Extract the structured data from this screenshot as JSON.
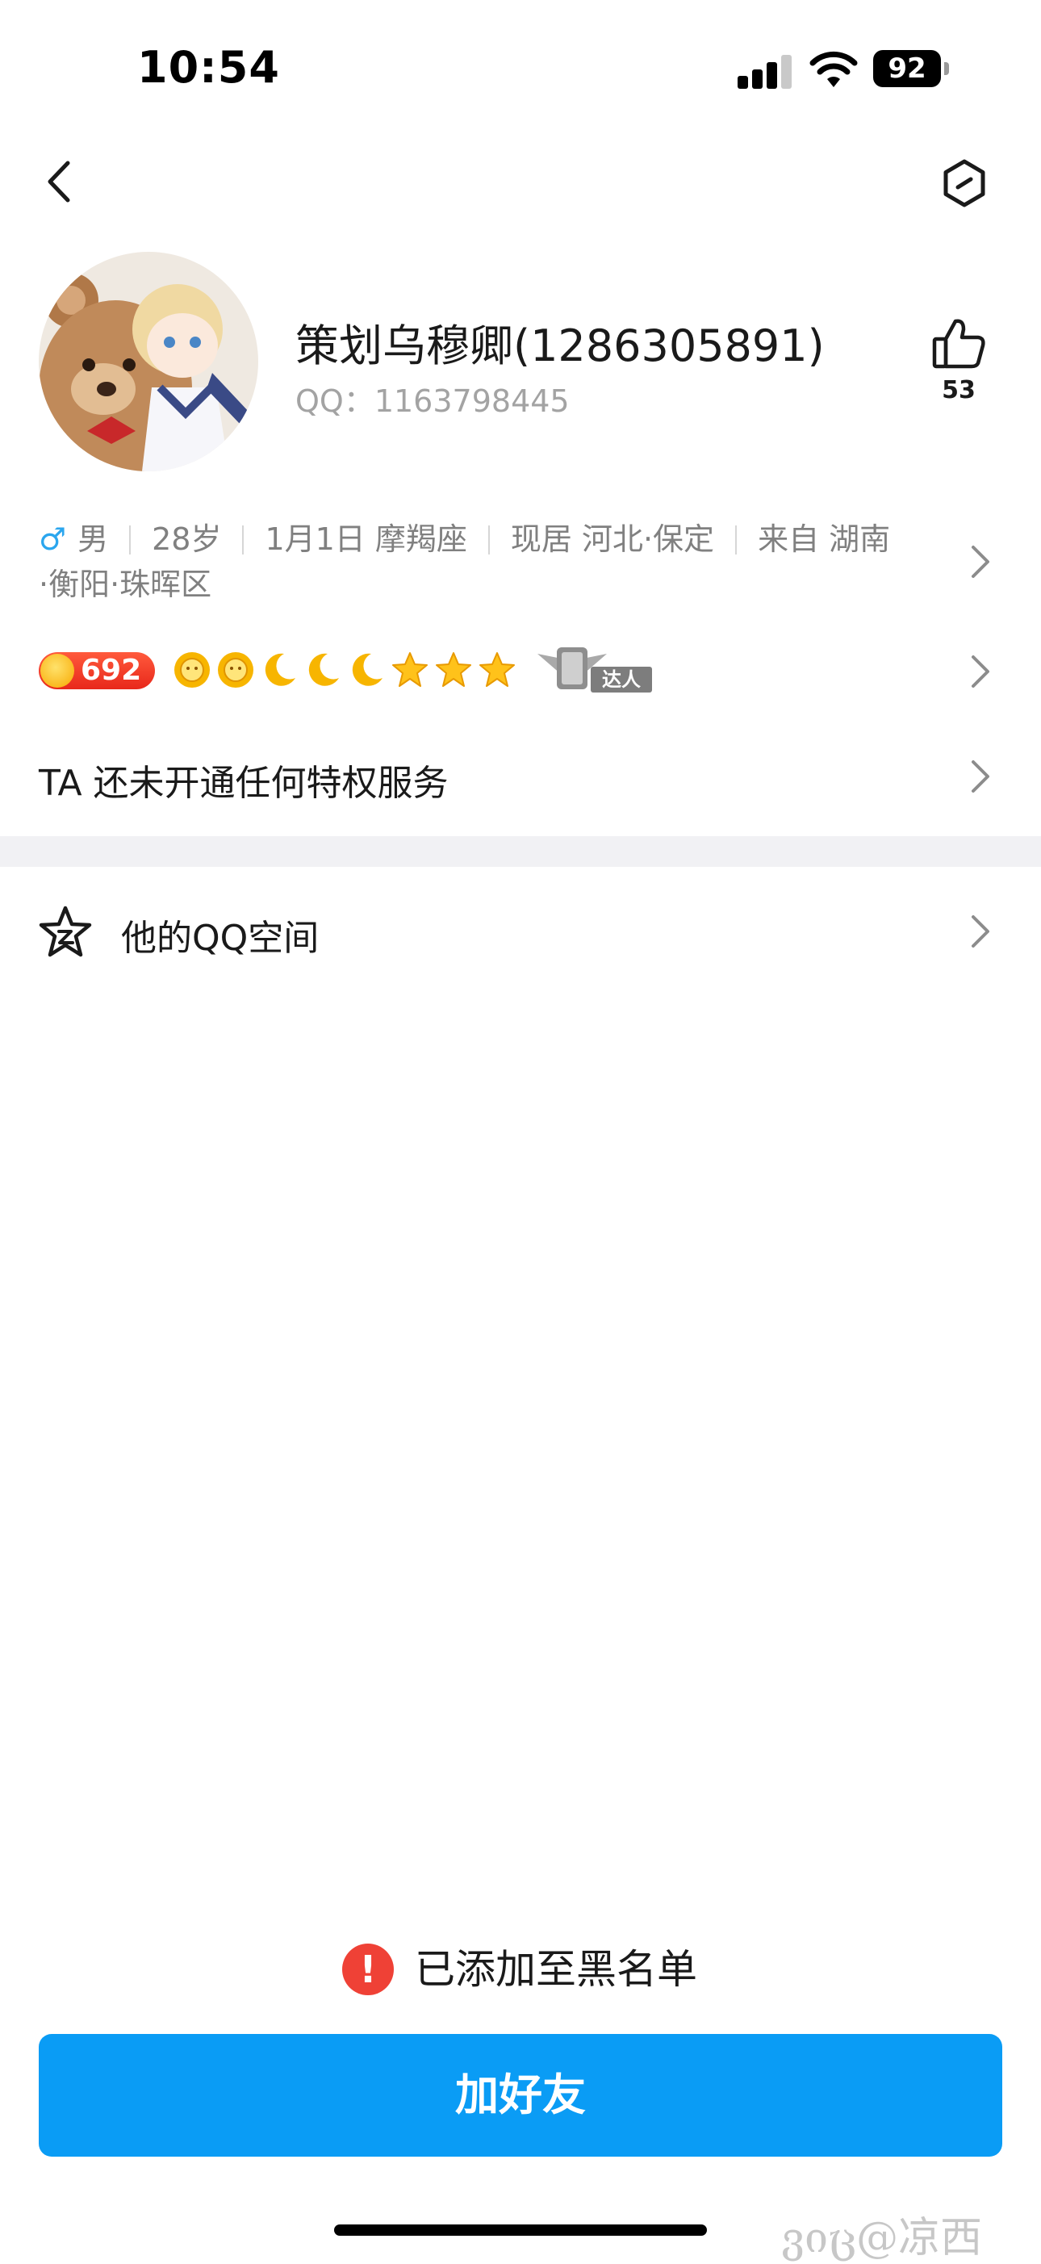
{
  "status_bar": {
    "time": "10:54",
    "battery": "92"
  },
  "nav": {
    "back_icon": "chevron-left-icon",
    "settings_icon": "hexagon-settings-icon"
  },
  "profile": {
    "nickname": "策划乌穆卿(1286305891)",
    "qq_label": "QQ：",
    "qq_number": "1163798445",
    "likes": "53"
  },
  "info": {
    "gender_symbol": "♂",
    "gender": "男",
    "age": "28岁",
    "birthday": "1月1日 摩羯座",
    "residence": "现居 河北·保定",
    "hometown_line1": "来自 湖南",
    "hometown_line2": "·衡阳·珠晖区"
  },
  "level": {
    "coin_value": "692",
    "icons": [
      "sun-icon",
      "sun-icon",
      "moon-icon",
      "moon-icon",
      "moon-icon",
      "star-icon",
      "star-icon",
      "star-icon"
    ],
    "daren_label": "达人"
  },
  "privilege": {
    "text": "TA 还未开通任何特权服务"
  },
  "qzone": {
    "label": "他的QQ空间"
  },
  "bottom": {
    "blacklist_icon": "!",
    "blacklist_text": "已添加至黑名单",
    "add_friend_label": "加好友",
    "watermark": "ვიც@凉西"
  },
  "colors": {
    "accent": "#0a9cf5",
    "danger": "#ef4136",
    "male": "#2ba6ee",
    "level_badge": "#e8281b"
  }
}
